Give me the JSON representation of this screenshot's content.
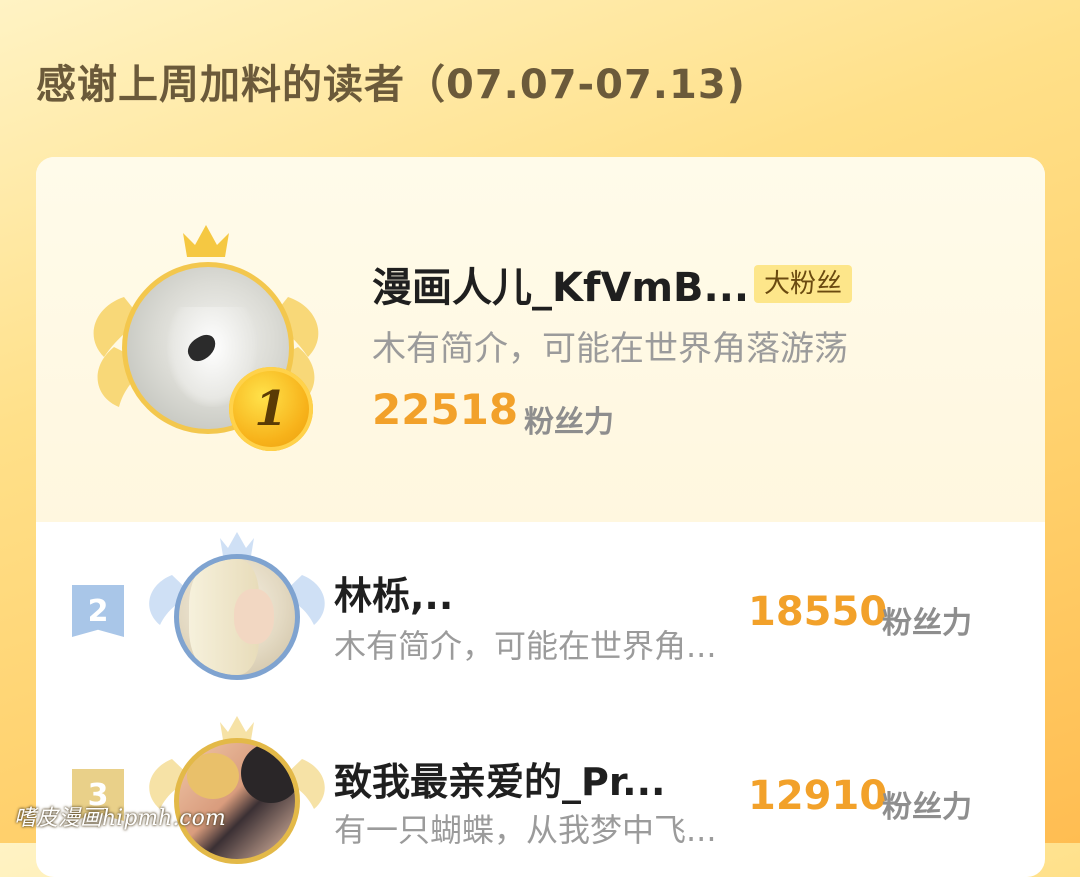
{
  "header": {
    "title": "感谢上周加料的读者（07.07-07.13)"
  },
  "leaderboard": [
    {
      "rank": "1",
      "name": "漫画人儿_KfVmB...",
      "badge": "大粉丝",
      "bio": "木有简介，可能在世界角落游荡",
      "score": "22518",
      "unit": "粉丝力"
    },
    {
      "rank": "2",
      "name": "林栎,..",
      "bio": "木有简介，可能在世界角...",
      "score": "18550",
      "unit": "粉丝力"
    },
    {
      "rank": "3",
      "name": "致我最亲爱的_Pr...",
      "bio": "有一只蝴蝶，从我梦中飞...",
      "score": "12910",
      "unit": "粉丝力"
    }
  ],
  "watermark": "嗜皮漫画hipmh.com",
  "colors": {
    "accent": "#f2a12a",
    "gold": "#f3c74d",
    "silver": "#7fa3d0"
  }
}
